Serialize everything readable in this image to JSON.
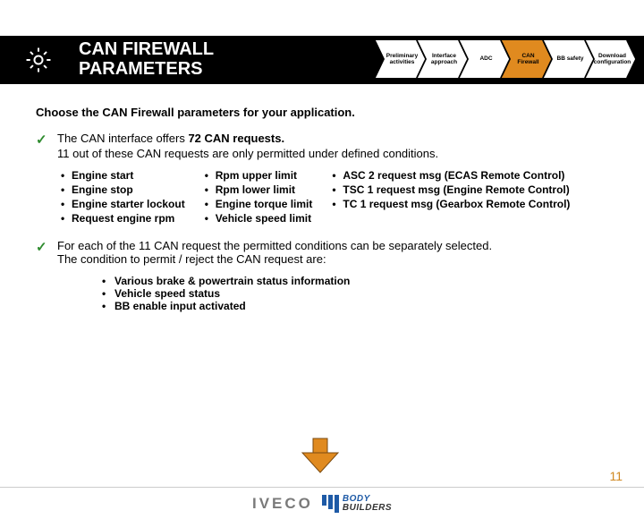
{
  "title": "CAN FIREWALL\nPARAMETERS",
  "steps": [
    {
      "label": "Preliminary activities",
      "active": false
    },
    {
      "label": "Interface approach",
      "active": false
    },
    {
      "label": "ADC",
      "active": false
    },
    {
      "label": "CAN Firewall",
      "active": true
    },
    {
      "label": "BB safety",
      "active": false
    },
    {
      "label": "Download configuration",
      "active": false
    }
  ],
  "instruction": "Choose the CAN Firewall parameters for your application.",
  "para1": {
    "lead": "The CAN interface offers ",
    "count": "72 CAN requests.",
    "line2": "11 out of these CAN requests are only permitted under defined conditions."
  },
  "cols": {
    "c1": [
      "Engine start",
      "Engine stop",
      "Engine starter lockout",
      "Request engine rpm"
    ],
    "c2": [
      "Rpm upper limit",
      "Rpm lower limit",
      "Engine torque limit",
      "Vehicle speed limit"
    ],
    "c3": [
      "ASC 2 request msg (ECAS Remote Control)",
      "TSC 1 request msg (Engine Remote Control)",
      "TC 1 request msg (Gearbox Remote Control)"
    ]
  },
  "para2": {
    "line1": "For each of the 11 CAN request the permitted conditions can be separately selected.",
    "line2": "The condition to permit / reject the CAN request are:"
  },
  "conditions": [
    "Various brake & powertrain status information",
    "Vehicle speed status",
    "BB enable input activated"
  ],
  "footer": {
    "brand1": "IVECO",
    "brand2a": "BODY",
    "brand2b": "BUILDERS"
  },
  "pageNumber": "11"
}
